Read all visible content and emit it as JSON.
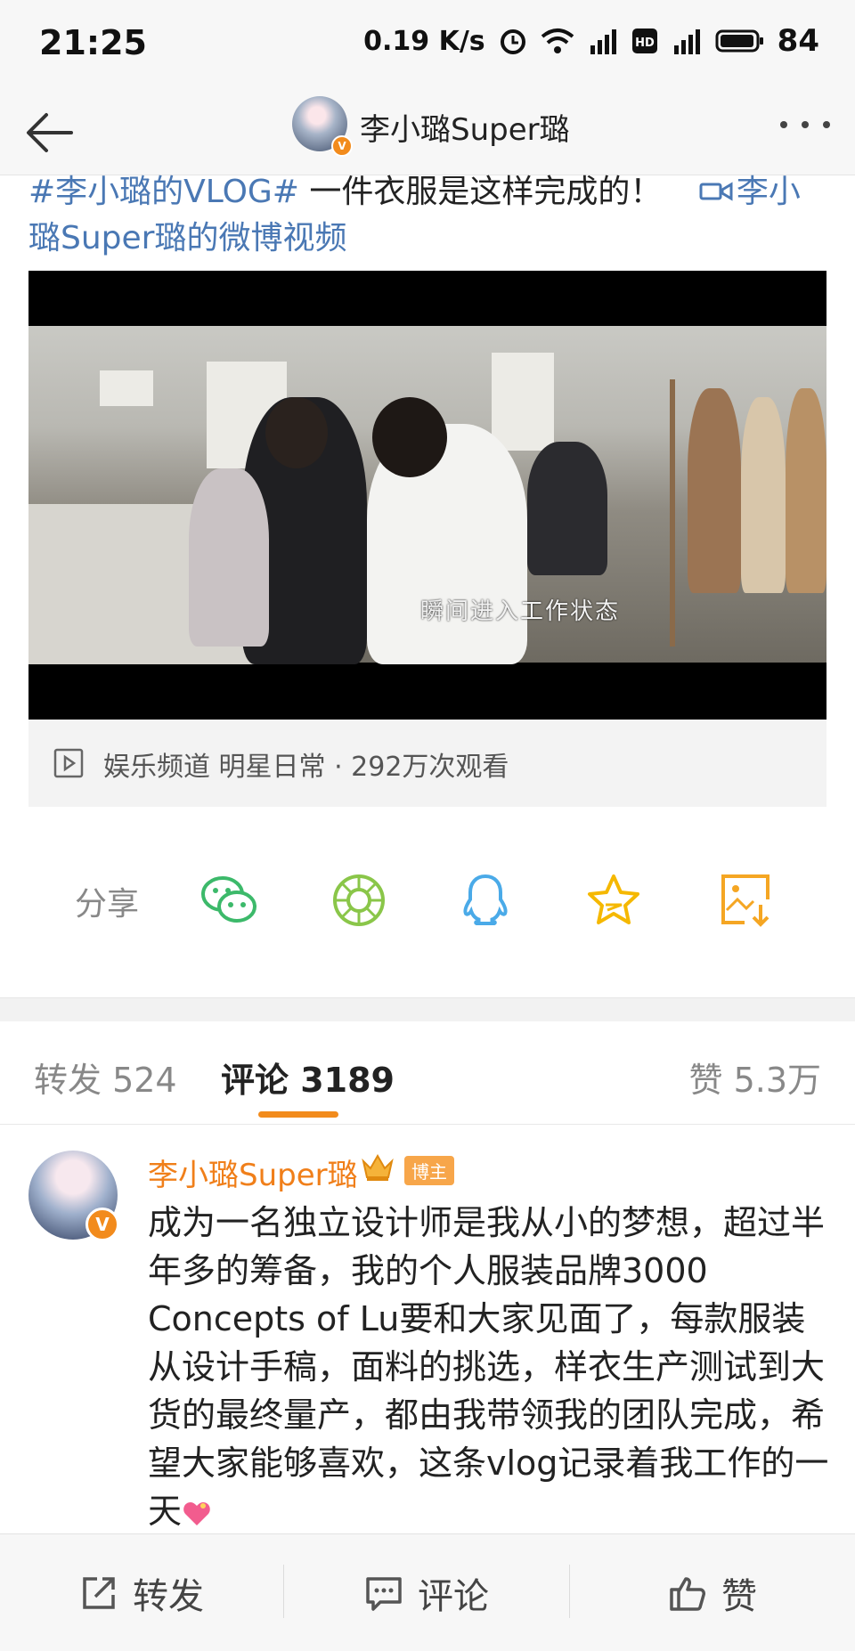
{
  "status_bar": {
    "time": "21:25",
    "net_speed": "0.19 K/s",
    "battery": "84",
    "icons": [
      "alarm-icon",
      "wifi-icon",
      "signal-4g-icon",
      "hd-icon",
      "signal-4g-icon",
      "battery-icon"
    ]
  },
  "nav": {
    "title": "李小璐Super璐",
    "back_icon": "back-arrow-icon",
    "more_icon": "more-icon"
  },
  "post": {
    "hashtag": "#李小璐的VLOG#",
    "text": " 一件衣服是这样完成的！ ",
    "video_link": "李小璐Super璐的微博视频",
    "video_caption": "瞬间进入工作状态",
    "video_meta": "娱乐频道 明星日常 · 292万次观看"
  },
  "share": {
    "label": "分享",
    "targets": [
      "wechat-icon",
      "moments-icon",
      "qq-icon",
      "favorite-icon",
      "save-image-icon"
    ]
  },
  "tabs": {
    "repost": "转发 524",
    "comments": "评论 3189",
    "likes": "赞 5.3万"
  },
  "comment": {
    "name": "李小璐Super璐",
    "badge": "博主",
    "text": "成为一名独立设计师是我从小的梦想，超过半年多的筹备，我的个人服装品牌3000 Concepts of Lu要和大家见面了，每款服装从设计手稿，面料的挑选，样衣生产测试到大货的最终量产，都由我带领我的团队完成，希望大家能够喜欢，这条vlog记录着我工作的一天"
  },
  "bottom_bar": {
    "repost": "转发",
    "comment": "评论",
    "like": "赞"
  },
  "colors": {
    "accent": "#f28b1c",
    "link": "#4a78b4",
    "wechat": "#3cb96a",
    "moments": "#8ac649",
    "qq": "#4aaae8",
    "favorite": "#f5b800",
    "save": "#f5a623"
  }
}
